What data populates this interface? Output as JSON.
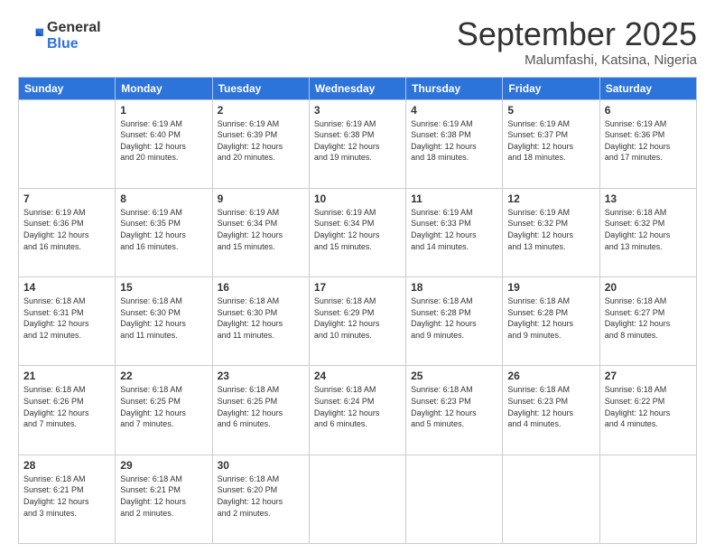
{
  "logo": {
    "general": "General",
    "blue": "Blue"
  },
  "title": "September 2025",
  "subtitle": "Malumfashi, Katsina, Nigeria",
  "header_days": [
    "Sunday",
    "Monday",
    "Tuesday",
    "Wednesday",
    "Thursday",
    "Friday",
    "Saturday"
  ],
  "weeks": [
    [
      {
        "day": "",
        "info": ""
      },
      {
        "day": "1",
        "info": "Sunrise: 6:19 AM\nSunset: 6:40 PM\nDaylight: 12 hours\nand 20 minutes."
      },
      {
        "day": "2",
        "info": "Sunrise: 6:19 AM\nSunset: 6:39 PM\nDaylight: 12 hours\nand 20 minutes."
      },
      {
        "day": "3",
        "info": "Sunrise: 6:19 AM\nSunset: 6:38 PM\nDaylight: 12 hours\nand 19 minutes."
      },
      {
        "day": "4",
        "info": "Sunrise: 6:19 AM\nSunset: 6:38 PM\nDaylight: 12 hours\nand 18 minutes."
      },
      {
        "day": "5",
        "info": "Sunrise: 6:19 AM\nSunset: 6:37 PM\nDaylight: 12 hours\nand 18 minutes."
      },
      {
        "day": "6",
        "info": "Sunrise: 6:19 AM\nSunset: 6:36 PM\nDaylight: 12 hours\nand 17 minutes."
      }
    ],
    [
      {
        "day": "7",
        "info": "Sunrise: 6:19 AM\nSunset: 6:36 PM\nDaylight: 12 hours\nand 16 minutes."
      },
      {
        "day": "8",
        "info": "Sunrise: 6:19 AM\nSunset: 6:35 PM\nDaylight: 12 hours\nand 16 minutes."
      },
      {
        "day": "9",
        "info": "Sunrise: 6:19 AM\nSunset: 6:34 PM\nDaylight: 12 hours\nand 15 minutes."
      },
      {
        "day": "10",
        "info": "Sunrise: 6:19 AM\nSunset: 6:34 PM\nDaylight: 12 hours\nand 15 minutes."
      },
      {
        "day": "11",
        "info": "Sunrise: 6:19 AM\nSunset: 6:33 PM\nDaylight: 12 hours\nand 14 minutes."
      },
      {
        "day": "12",
        "info": "Sunrise: 6:19 AM\nSunset: 6:32 PM\nDaylight: 12 hours\nand 13 minutes."
      },
      {
        "day": "13",
        "info": "Sunrise: 6:18 AM\nSunset: 6:32 PM\nDaylight: 12 hours\nand 13 minutes."
      }
    ],
    [
      {
        "day": "14",
        "info": "Sunrise: 6:18 AM\nSunset: 6:31 PM\nDaylight: 12 hours\nand 12 minutes."
      },
      {
        "day": "15",
        "info": "Sunrise: 6:18 AM\nSunset: 6:30 PM\nDaylight: 12 hours\nand 11 minutes."
      },
      {
        "day": "16",
        "info": "Sunrise: 6:18 AM\nSunset: 6:30 PM\nDaylight: 12 hours\nand 11 minutes."
      },
      {
        "day": "17",
        "info": "Sunrise: 6:18 AM\nSunset: 6:29 PM\nDaylight: 12 hours\nand 10 minutes."
      },
      {
        "day": "18",
        "info": "Sunrise: 6:18 AM\nSunset: 6:28 PM\nDaylight: 12 hours\nand 9 minutes."
      },
      {
        "day": "19",
        "info": "Sunrise: 6:18 AM\nSunset: 6:28 PM\nDaylight: 12 hours\nand 9 minutes."
      },
      {
        "day": "20",
        "info": "Sunrise: 6:18 AM\nSunset: 6:27 PM\nDaylight: 12 hours\nand 8 minutes."
      }
    ],
    [
      {
        "day": "21",
        "info": "Sunrise: 6:18 AM\nSunset: 6:26 PM\nDaylight: 12 hours\nand 7 minutes."
      },
      {
        "day": "22",
        "info": "Sunrise: 6:18 AM\nSunset: 6:25 PM\nDaylight: 12 hours\nand 7 minutes."
      },
      {
        "day": "23",
        "info": "Sunrise: 6:18 AM\nSunset: 6:25 PM\nDaylight: 12 hours\nand 6 minutes."
      },
      {
        "day": "24",
        "info": "Sunrise: 6:18 AM\nSunset: 6:24 PM\nDaylight: 12 hours\nand 6 minutes."
      },
      {
        "day": "25",
        "info": "Sunrise: 6:18 AM\nSunset: 6:23 PM\nDaylight: 12 hours\nand 5 minutes."
      },
      {
        "day": "26",
        "info": "Sunrise: 6:18 AM\nSunset: 6:23 PM\nDaylight: 12 hours\nand 4 minutes."
      },
      {
        "day": "27",
        "info": "Sunrise: 6:18 AM\nSunset: 6:22 PM\nDaylight: 12 hours\nand 4 minutes."
      }
    ],
    [
      {
        "day": "28",
        "info": "Sunrise: 6:18 AM\nSunset: 6:21 PM\nDaylight: 12 hours\nand 3 minutes."
      },
      {
        "day": "29",
        "info": "Sunrise: 6:18 AM\nSunset: 6:21 PM\nDaylight: 12 hours\nand 2 minutes."
      },
      {
        "day": "30",
        "info": "Sunrise: 6:18 AM\nSunset: 6:20 PM\nDaylight: 12 hours\nand 2 minutes."
      },
      {
        "day": "",
        "info": ""
      },
      {
        "day": "",
        "info": ""
      },
      {
        "day": "",
        "info": ""
      },
      {
        "day": "",
        "info": ""
      }
    ]
  ]
}
